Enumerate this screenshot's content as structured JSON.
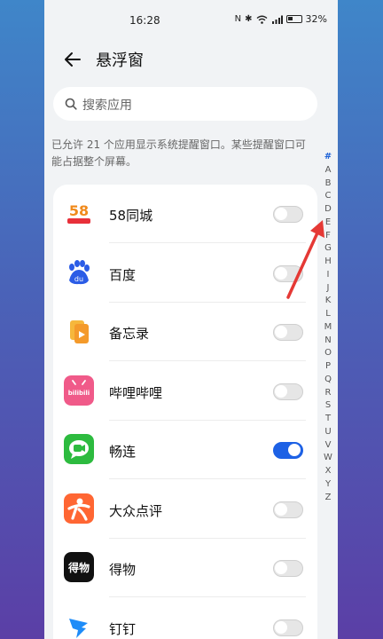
{
  "status": {
    "time": "16:28",
    "battery": "32%"
  },
  "header": {
    "title": "悬浮窗"
  },
  "search": {
    "placeholder": "搜索应用"
  },
  "description": "已允许 21 个应用显示系统提醒窗口。某些提醒窗口可能占据整个屏幕。",
  "alphabet": [
    "#",
    "A",
    "B",
    "C",
    "D",
    "E",
    "F",
    "G",
    "H",
    "I",
    "J",
    "K",
    "L",
    "M",
    "N",
    "O",
    "P",
    "Q",
    "R",
    "S",
    "T",
    "U",
    "V",
    "W",
    "X",
    "Y",
    "Z"
  ],
  "apps": [
    {
      "name": "58同城",
      "enabled": false,
      "icon": "58-tongcheng-icon",
      "icon_text": "58"
    },
    {
      "name": "百度",
      "enabled": false,
      "icon": "baidu-icon",
      "icon_text": "du"
    },
    {
      "name": "备忘录",
      "enabled": false,
      "icon": "memo-icon"
    },
    {
      "name": "哔哩哔哩",
      "enabled": false,
      "icon": "bilibili-icon",
      "icon_text": "bilibili"
    },
    {
      "name": "畅连",
      "enabled": true,
      "icon": "changlian-icon"
    },
    {
      "name": "大众点评",
      "enabled": false,
      "icon": "dianping-icon"
    },
    {
      "name": "得物",
      "enabled": false,
      "icon": "dewu-icon",
      "icon_text": "得物"
    },
    {
      "name": "钉钉",
      "enabled": false,
      "icon": "dingtalk-icon"
    }
  ],
  "colors": {
    "accent": "#1d61e5",
    "arrow": "#e53935"
  }
}
